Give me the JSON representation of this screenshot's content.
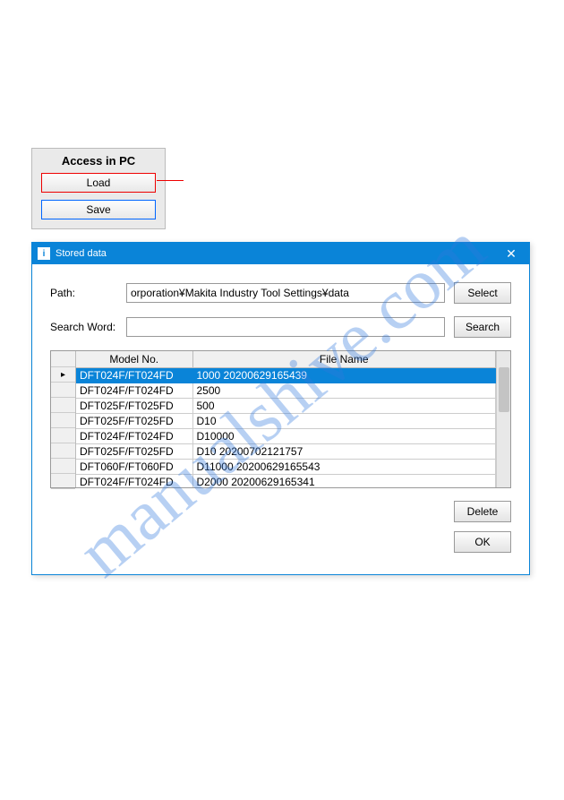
{
  "watermark": "manualshive.com",
  "access_panel": {
    "title": "Access in PC",
    "load_label": "Load",
    "save_label": "Save"
  },
  "dialog": {
    "title": "Stored data",
    "path_label": "Path:",
    "path_value": "orporation¥Makita Industry Tool Settings¥data",
    "select_label": "Select",
    "search_label": "Search Word:",
    "search_value": "",
    "search_btn_label": "Search",
    "columns": [
      "Model No.",
      "File Name"
    ],
    "rows": [
      {
        "model": "DFT024F/FT024FD",
        "file": "1000 20200629165439",
        "selected": true
      },
      {
        "model": "DFT024F/FT024FD",
        "file": "2500"
      },
      {
        "model": "DFT025F/FT025FD",
        "file": "500"
      },
      {
        "model": "DFT025F/FT025FD",
        "file": "D10"
      },
      {
        "model": "DFT024F/FT024FD",
        "file": "D10000"
      },
      {
        "model": "DFT025F/FT025FD",
        "file": "D10 20200702121757"
      },
      {
        "model": "DFT060F/FT060FD",
        "file": "D11000 20200629165543"
      },
      {
        "model": "DFT024F/FT024FD",
        "file": "D2000 20200629165341"
      }
    ],
    "delete_label": "Delete",
    "ok_label": "OK"
  }
}
